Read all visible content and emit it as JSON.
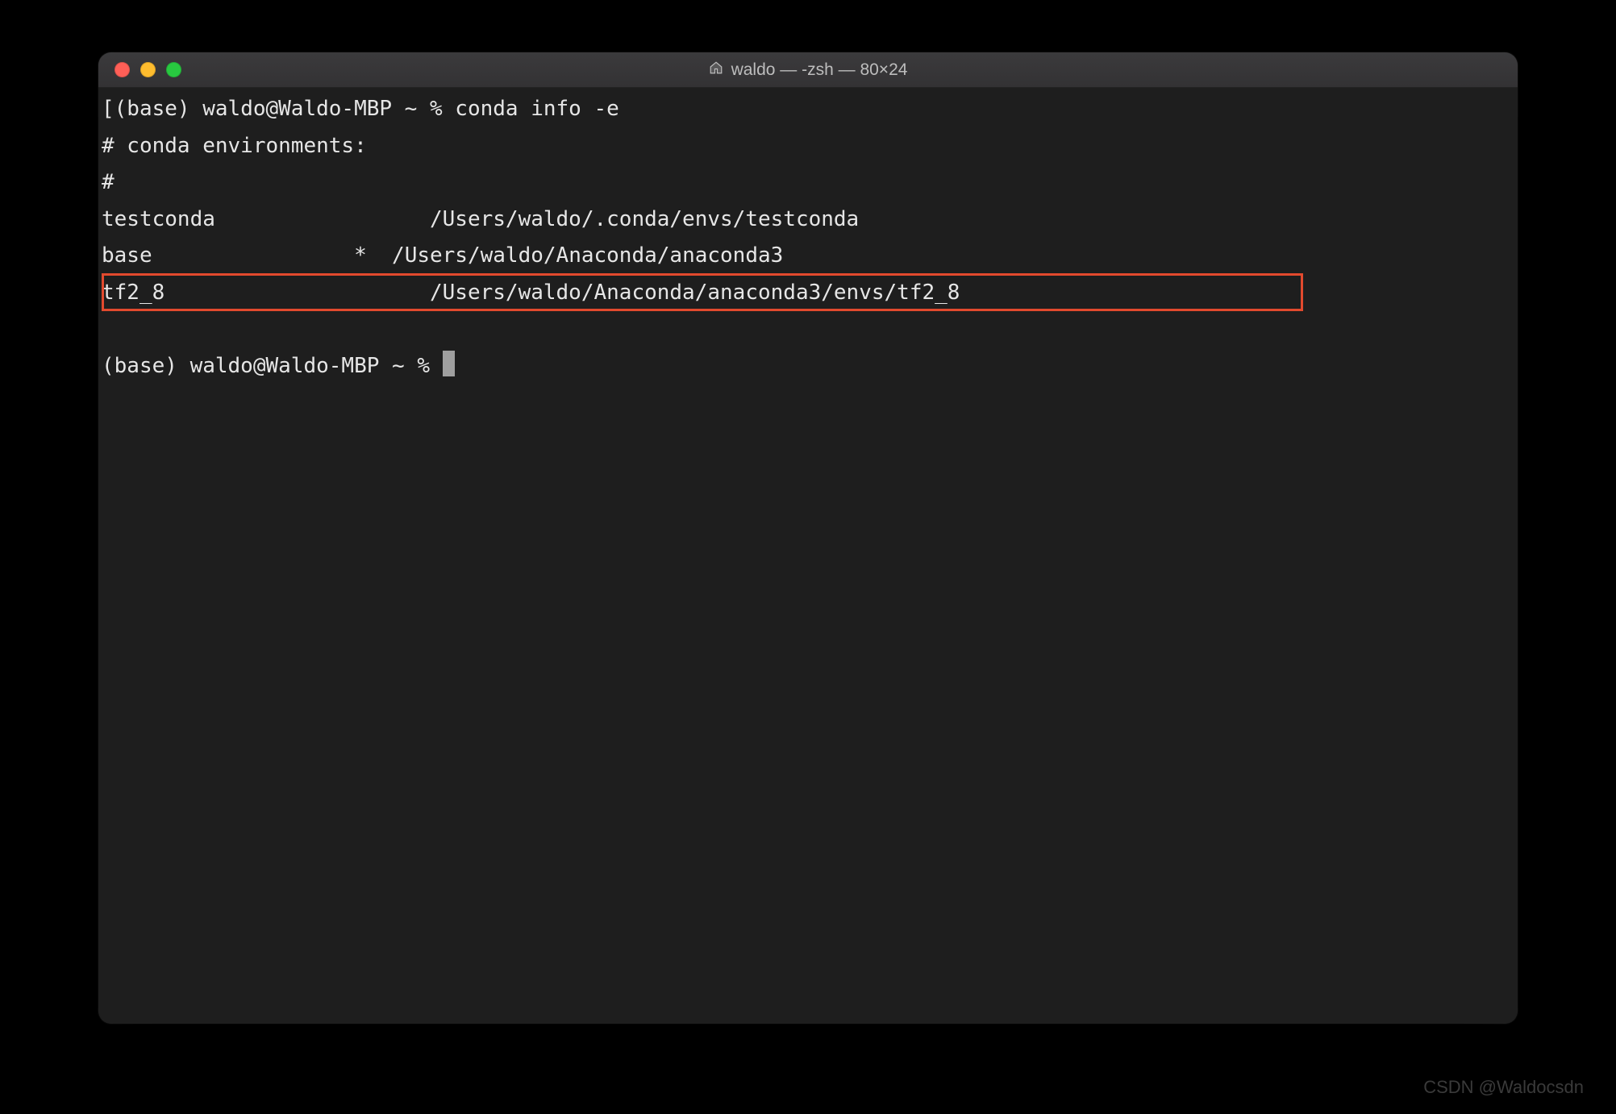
{
  "window": {
    "title": "waldo — -zsh — 80×24"
  },
  "terminal": {
    "prompt1_bracket": "[",
    "prompt1": "(base) waldo@Waldo-MBP ~ % ",
    "command1": "conda info -e",
    "header_line": "# conda environments:",
    "hash_line": "#",
    "envs": [
      {
        "name": "testconda              ",
        "active": " ",
        "path": "  /Users/waldo/.conda/envs/testconda"
      },
      {
        "name": "base                ",
        "active": "*",
        "path": "  /Users/waldo/Anaconda/anaconda3"
      },
      {
        "name": "tf2_8                  ",
        "active": " ",
        "path": "  /Users/waldo/Anaconda/anaconda3/envs/tf2_8"
      }
    ],
    "blank": " ",
    "prompt2": "(base) waldo@Waldo-MBP ~ % ",
    "trailing_bracket": "]"
  },
  "annotation": {
    "highlight_color": "#e24a2e"
  },
  "watermark": "CSDN @Waldocsdn"
}
